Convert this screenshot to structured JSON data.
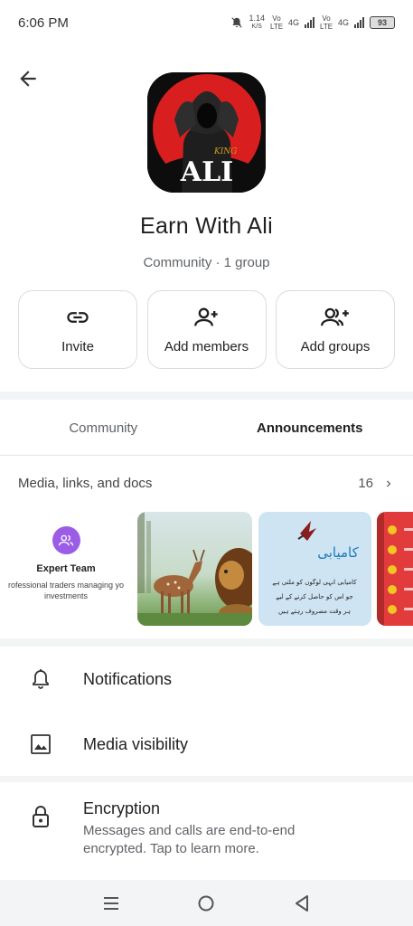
{
  "status_bar": {
    "time": "6:06 PM",
    "net_speed_value": "1.14",
    "net_speed_unit": "K/S",
    "sim1_lte": "Vo LTE",
    "sim1_gen": "4G",
    "sim2_lte": "Vo LTE",
    "sim2_gen": "4G",
    "battery": "93",
    "icons": [
      "mute-icon",
      "signal-icon",
      "battery-icon"
    ]
  },
  "header": {
    "back_icon": "arrow-left-icon",
    "avatar_text": "ALI",
    "avatar_crown": "KING",
    "title": "Earn With Ali",
    "subtitle": "Community · 1 group"
  },
  "actions": [
    {
      "label": "Invite",
      "icon": "link-icon"
    },
    {
      "label": "Add members",
      "icon": "person-add-icon"
    },
    {
      "label": "Add groups",
      "icon": "group-add-icon"
    }
  ],
  "tabs": [
    {
      "label": "Community",
      "active": false
    },
    {
      "label": "Announcements",
      "active": true
    }
  ],
  "media": {
    "label": "Media, links, and docs",
    "count": "16",
    "items": [
      {
        "type": "group-card",
        "name": "Expert Team",
        "desc": "rofessional traders managing yo",
        "desc2": "investments"
      },
      {
        "type": "image",
        "subject": "deer-and-lion"
      },
      {
        "type": "image",
        "title": "کامیابی",
        "lines": [
          "کامیابی انہی لوگوں کو ملتی ہے",
          "جو اس کو حاصل کرنے کے لیے",
          "ہر وقت مصروف رہتے ہیں"
        ]
      },
      {
        "type": "image",
        "subject": "red-list"
      }
    ]
  },
  "settings": {
    "notifications": "Notifications",
    "media_visibility": "Media visibility",
    "encryption_title": "Encryption",
    "encryption_line1": "Messages and calls are end-to-end",
    "encryption_line2": "encrypted. Tap to learn more."
  },
  "nav": {
    "icons": [
      "menu-icon",
      "home-icon",
      "back-icon"
    ]
  },
  "colors": {
    "accent_purple": "#9b5de5",
    "avatar_red": "#d81e1e",
    "text_primary": "#1f1f1f",
    "text_secondary": "#5f6368"
  }
}
